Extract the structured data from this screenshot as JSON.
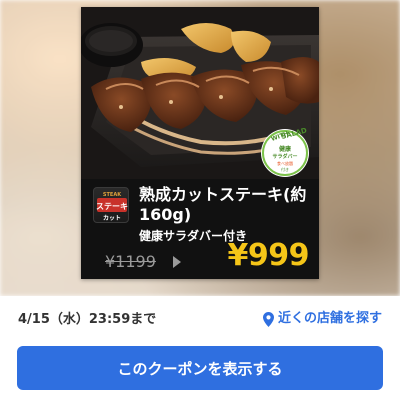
{
  "coupon": {
    "badge": {
      "with_text": "WITH",
      "salad_text": "SALAD",
      "line1": "健康",
      "line2": "サラダバー",
      "line3": "食べ放題",
      "line4": "付き"
    },
    "logo": {
      "top_text": "STEAK",
      "main_text": "ステーキ",
      "bottom_text": "カット"
    },
    "title": "熟成カットステーキ(約160g)",
    "subtitle": "健康サラダバー付き",
    "old_price": "¥1199",
    "new_price": "¥999",
    "colors": {
      "price": "#f5c518",
      "card_bg": "#111111"
    }
  },
  "meta": {
    "deadline": "4/15（水）23:59まで",
    "store_link": "近くの店舗を探す",
    "store_icon": "location-pin-icon"
  },
  "cta": {
    "label": "このクーポンを表示する",
    "color": "#2f6fe0"
  }
}
